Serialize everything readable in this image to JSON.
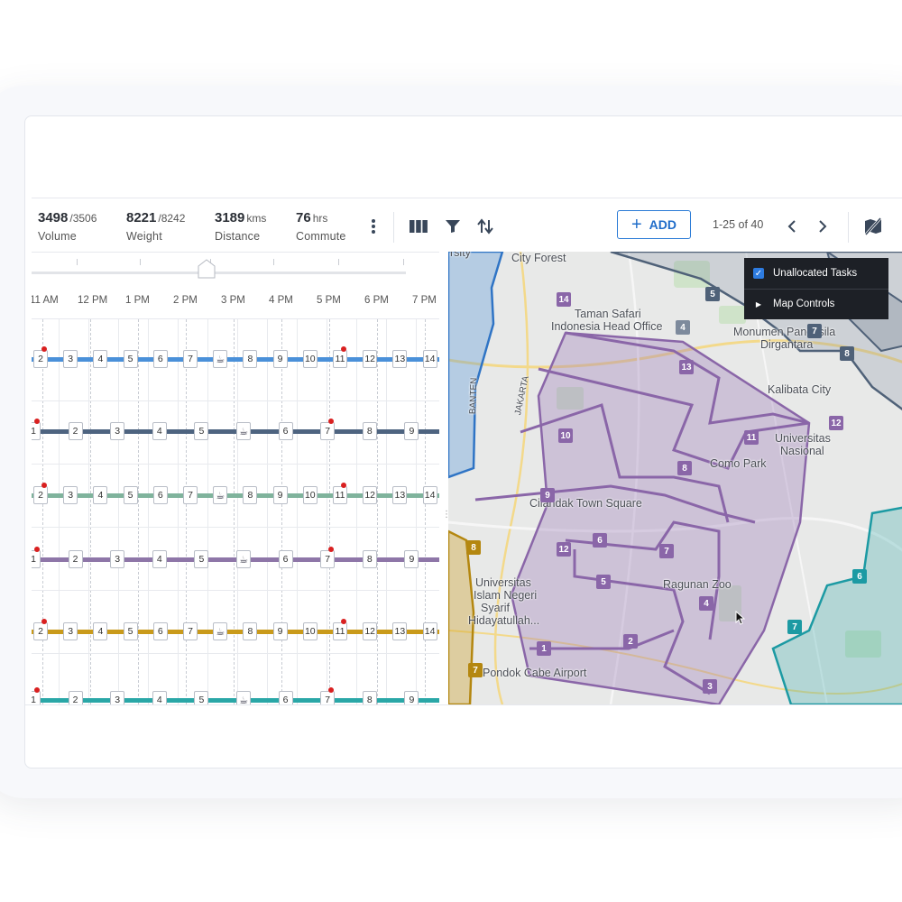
{
  "toolbar": {
    "metrics": [
      {
        "value": "3498",
        "sub": "/3506",
        "label": "Volume"
      },
      {
        "value": "8221",
        "sub": "/8242",
        "label": "Weight"
      },
      {
        "value": "3189",
        "sub": "kms",
        "label": "Distance"
      },
      {
        "value": "76",
        "sub": "hrs",
        "label": "Commute"
      }
    ],
    "add_label": "ADD",
    "pager_text": "1-25 of 40",
    "icons": [
      "more-vertical-icon",
      "columns-icon",
      "filter-icon",
      "sort-icon",
      "add-icon",
      "chevron-left-icon",
      "chevron-right-icon",
      "map-off-icon"
    ]
  },
  "timeline": {
    "hours": [
      "11 AM",
      "12 PM",
      "1 PM",
      "2 PM",
      "3 PM",
      "4 PM",
      "5 PM",
      "6 PM",
      "7 PM"
    ],
    "routes": [
      {
        "color": "#4a90d9",
        "stops": [
          "2",
          "3",
          "4",
          "5",
          "6",
          "7",
          "☕",
          "8",
          "9",
          "10",
          "11",
          "12",
          "13",
          "14"
        ],
        "red_markers": [
          0,
          10
        ]
      },
      {
        "color": "#4e6480",
        "stops": [
          "1",
          "2",
          "3",
          "4",
          "5",
          "☕",
          "6",
          "7",
          "8",
          "9"
        ],
        "red_markers": [
          0,
          7
        ]
      },
      {
        "color": "#7fb39c",
        "stops": [
          "2",
          "3",
          "4",
          "5",
          "6",
          "7",
          "☕",
          "8",
          "9",
          "10",
          "11",
          "12",
          "13",
          "14"
        ],
        "red_markers": [
          0,
          10
        ]
      },
      {
        "color": "#8e76a8",
        "stops": [
          "1",
          "2",
          "3",
          "4",
          "5",
          "☕",
          "6",
          "7",
          "8",
          "9"
        ],
        "red_markers": [
          0,
          7
        ]
      },
      {
        "color": "#c99a1a",
        "stops": [
          "2",
          "3",
          "4",
          "5",
          "6",
          "7",
          "☕",
          "8",
          "9",
          "10",
          "11",
          "12",
          "13",
          "14"
        ],
        "red_markers": [
          0,
          10
        ]
      },
      {
        "color": "#2aa7a7",
        "stops": [
          "1",
          "2",
          "3",
          "4",
          "5",
          "☕",
          "6",
          "7",
          "8",
          "9"
        ],
        "red_markers": [
          0,
          7
        ]
      }
    ]
  },
  "map": {
    "places": [
      {
        "name": "City Forest"
      },
      {
        "name": "Taman Safari"
      },
      {
        "name": "Indonesia Head Office"
      },
      {
        "name": "Monumen Pancasila"
      },
      {
        "name": "Dirgantara"
      },
      {
        "name": "Kalibata City"
      },
      {
        "name": "Universitas"
      },
      {
        "name": "Nasional"
      },
      {
        "name": "Como Park"
      },
      {
        "name": "Cilandak Town Square"
      },
      {
        "name": "Ragunan Zoo"
      },
      {
        "name": "Universitas"
      },
      {
        "name": "Islam Negeri"
      },
      {
        "name": "Syarif"
      },
      {
        "name": "Hidayatullah..."
      },
      {
        "name": "Pondok Cabe Airport"
      },
      {
        "name": "JAKARTA"
      },
      {
        "name": "BANTEN"
      },
      {
        "name": "rsity"
      }
    ],
    "markers": [
      "14",
      "4",
      "13",
      "5",
      "7",
      "8",
      "12",
      "11",
      "10",
      "8",
      "9",
      "6",
      "12",
      "7",
      "5",
      "4",
      "1",
      "2",
      "3",
      "6",
      "7",
      "8",
      "7"
    ],
    "overlay": {
      "unallocated_label": "Unallocated Tasks",
      "map_controls_label": "Map Controls"
    }
  }
}
